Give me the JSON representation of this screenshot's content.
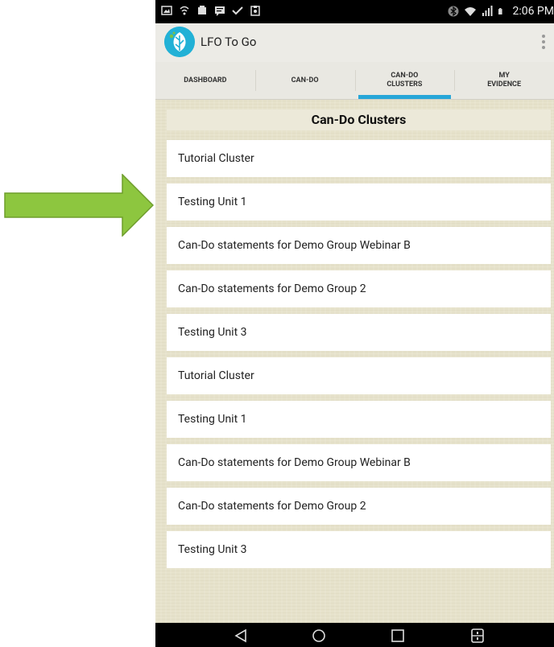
{
  "status_bar": {
    "time": "2:06 PM",
    "left_icons": [
      "image-icon",
      "wifi-calling-icon",
      "notification-icon",
      "message-icon",
      "check-icon",
      "clipboard-icon"
    ],
    "right_icons": [
      "bluetooth-icon",
      "wifi-icon",
      "signal-icon",
      "battery-icon"
    ]
  },
  "app": {
    "title": "LFO To Go",
    "brand_color": "#22b1d6"
  },
  "tabs": [
    {
      "label": "DASHBOARD",
      "active": false
    },
    {
      "label": "CAN-DO",
      "active": false
    },
    {
      "label": "CAN-DO\nCLUSTERS",
      "active": true
    },
    {
      "label": "MY\nEVIDENCE",
      "active": false
    }
  ],
  "accent_color": "#27a6d8",
  "section": {
    "title": "Can-Do Clusters"
  },
  "clusters": [
    "Tutorial Cluster",
    "Testing Unit 1",
    "Can-Do statements for Demo Group Webinar B",
    "Can-Do statements for Demo Group 2",
    "Testing Unit 3",
    "Tutorial Cluster",
    "Testing Unit 1",
    "Can-Do statements for Demo Group Webinar B",
    "Can-Do statements for Demo Group 2",
    "Testing Unit 3"
  ],
  "annotation": {
    "arrow_color": "#8dc63f"
  }
}
